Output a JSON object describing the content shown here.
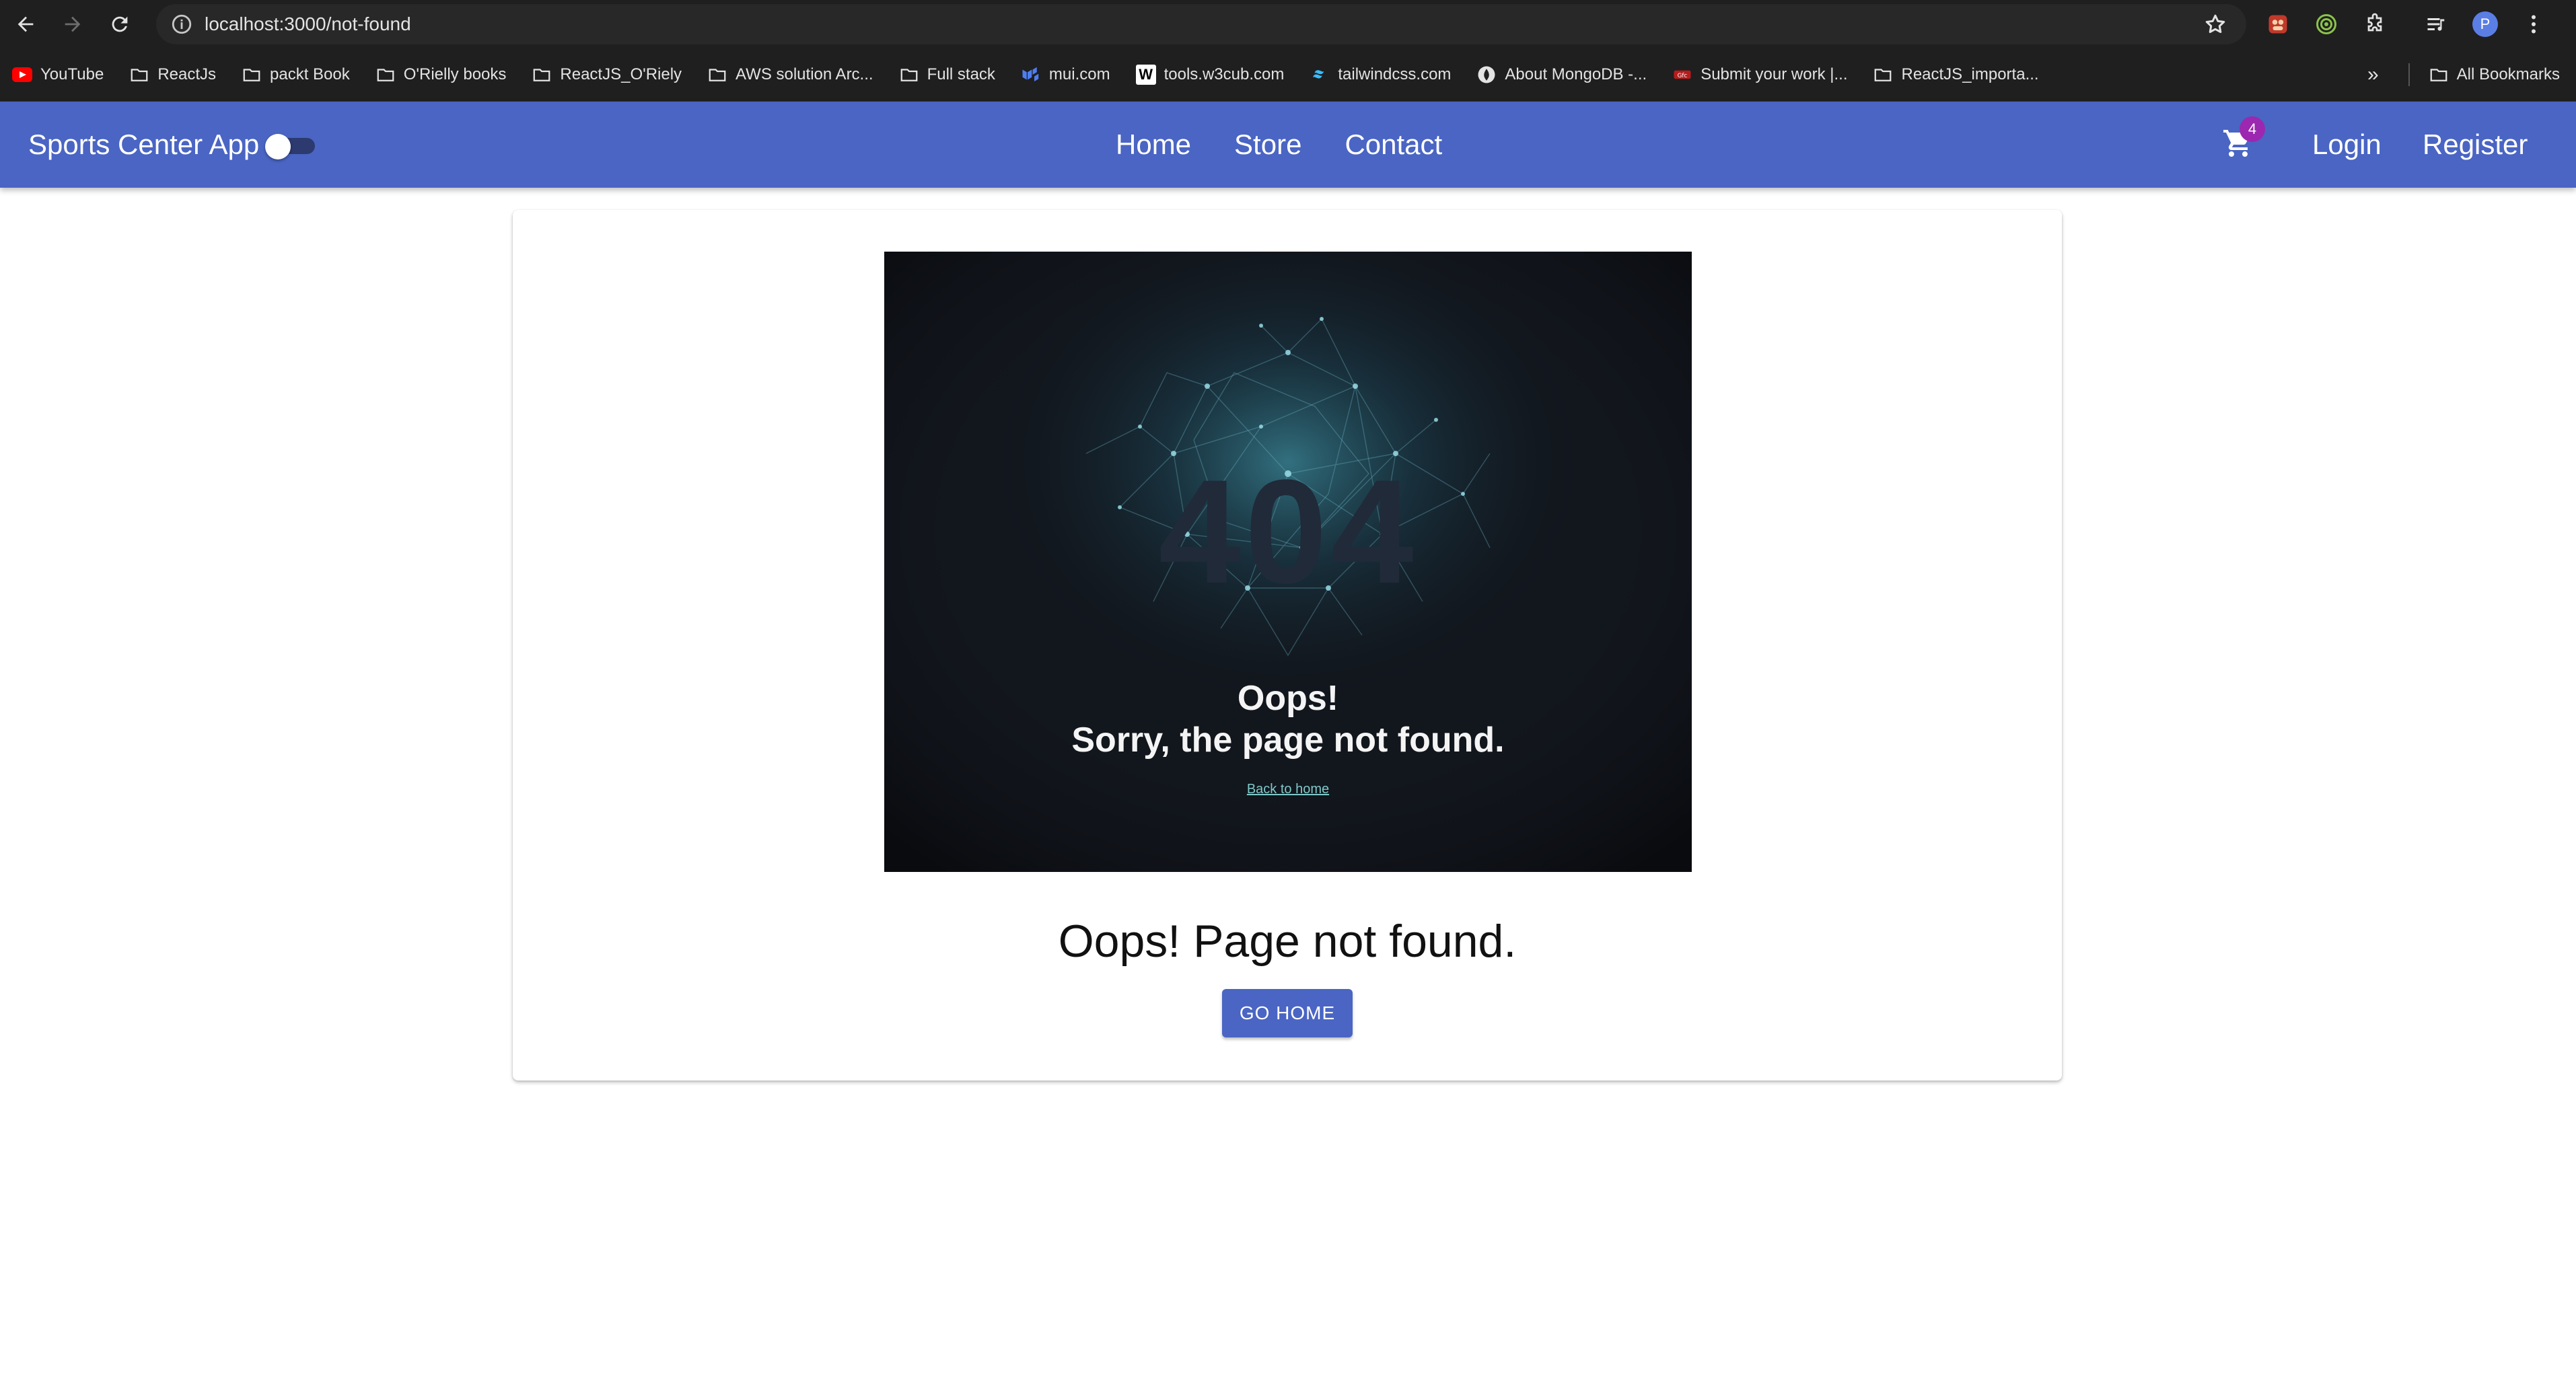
{
  "browser": {
    "url": "localhost:3000/not-found",
    "avatar_letter": "P",
    "bookmarks": [
      {
        "label": "YouTube",
        "icon": "youtube-icon"
      },
      {
        "label": "ReactJs",
        "icon": "folder-icon"
      },
      {
        "label": "packt Book",
        "icon": "folder-icon"
      },
      {
        "label": "O'Rielly books",
        "icon": "folder-icon"
      },
      {
        "label": "ReactJS_O'Riely",
        "icon": "folder-icon"
      },
      {
        "label": "AWS solution Arc...",
        "icon": "folder-icon"
      },
      {
        "label": "Full stack",
        "icon": "folder-icon"
      },
      {
        "label": "mui.com",
        "icon": "mui-icon"
      },
      {
        "label": "tools.w3cub.com",
        "icon": "w3cub-icon"
      },
      {
        "label": "tailwindcss.com",
        "icon": "tailwind-icon"
      },
      {
        "label": "About MongoDB -...",
        "icon": "mongodb-icon"
      },
      {
        "label": "Submit your work |...",
        "icon": "site-icon"
      },
      {
        "label": "ReactJS_importa...",
        "icon": "folder-icon"
      }
    ],
    "all_bookmarks_label": "All Bookmarks"
  },
  "appbar": {
    "title": "Sports Center App",
    "nav": [
      "Home",
      "Store",
      "Contact"
    ],
    "cart_count": "4",
    "login": "Login",
    "register": "Register",
    "color": "#4a65c3"
  },
  "content": {
    "image_text": {
      "code": "404",
      "line1": "Oops!",
      "line2": "Sorry, the page not found.",
      "back_link": "Back to home"
    },
    "heading": "Oops! Page not found.",
    "button": "GO HOME"
  }
}
